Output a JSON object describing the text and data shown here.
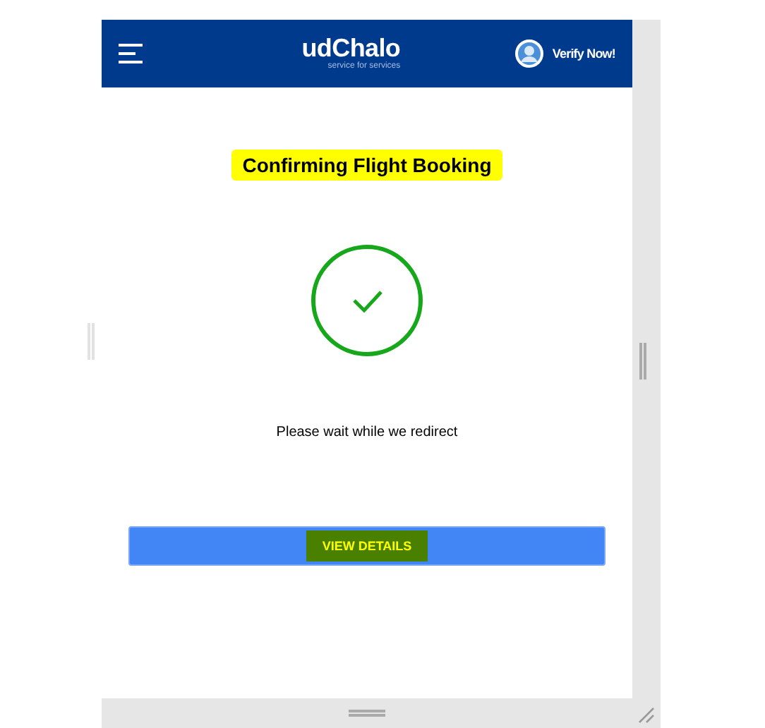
{
  "header": {
    "logo": "udChalo",
    "tagline": "service for services",
    "verify_label": "Verify Now!"
  },
  "title": "Confirming Flight Booking",
  "message": "Please wait while we redirect",
  "button": "VIEW DETAILS"
}
